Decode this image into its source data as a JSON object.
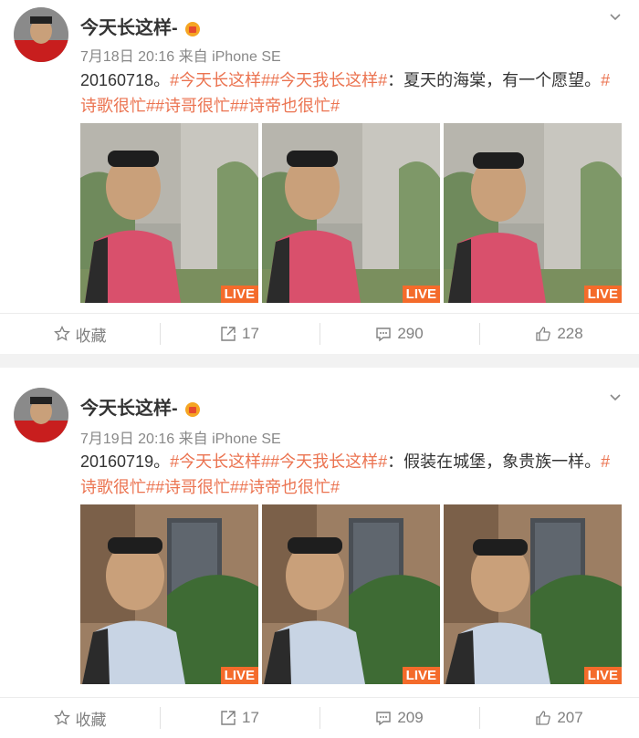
{
  "posts": [
    {
      "user": {
        "name": "今天长这样-"
      },
      "time": "7月18日 20:16 来自 iPhone SE",
      "text_lead": "20160718。",
      "tags1": [
        "#今天长这样#",
        "#今天我长这样#"
      ],
      "body": "：夏天的海棠，有一个愿望。",
      "tags2": [
        "#诗歌很忙#",
        "#诗哥很忙#",
        "#诗帝也很忙#"
      ],
      "photos": [
        "LIVE",
        "LIVE",
        "LIVE"
      ],
      "actions": {
        "favorite": "收藏",
        "repost": "17",
        "comment": "290",
        "like": "228"
      }
    },
    {
      "user": {
        "name": "今天长这样-"
      },
      "time": "7月19日 20:16 来自 iPhone SE",
      "text_lead": "20160719。",
      "tags1": [
        "#今天长这样#",
        "#今天我长这样#"
      ],
      "body": "：假装在城堡，象贵族一样。",
      "tags2": [
        "#诗歌很忙#",
        "#诗哥很忙#",
        "#诗帝也很忙#"
      ],
      "photos": [
        "LIVE",
        "LIVE",
        "LIVE"
      ],
      "actions": {
        "favorite": "收藏",
        "repost": "17",
        "comment": "209",
        "like": "207"
      }
    }
  ],
  "colors": {
    "tag": "#eb7350",
    "live_badge": "#f46b2b"
  }
}
